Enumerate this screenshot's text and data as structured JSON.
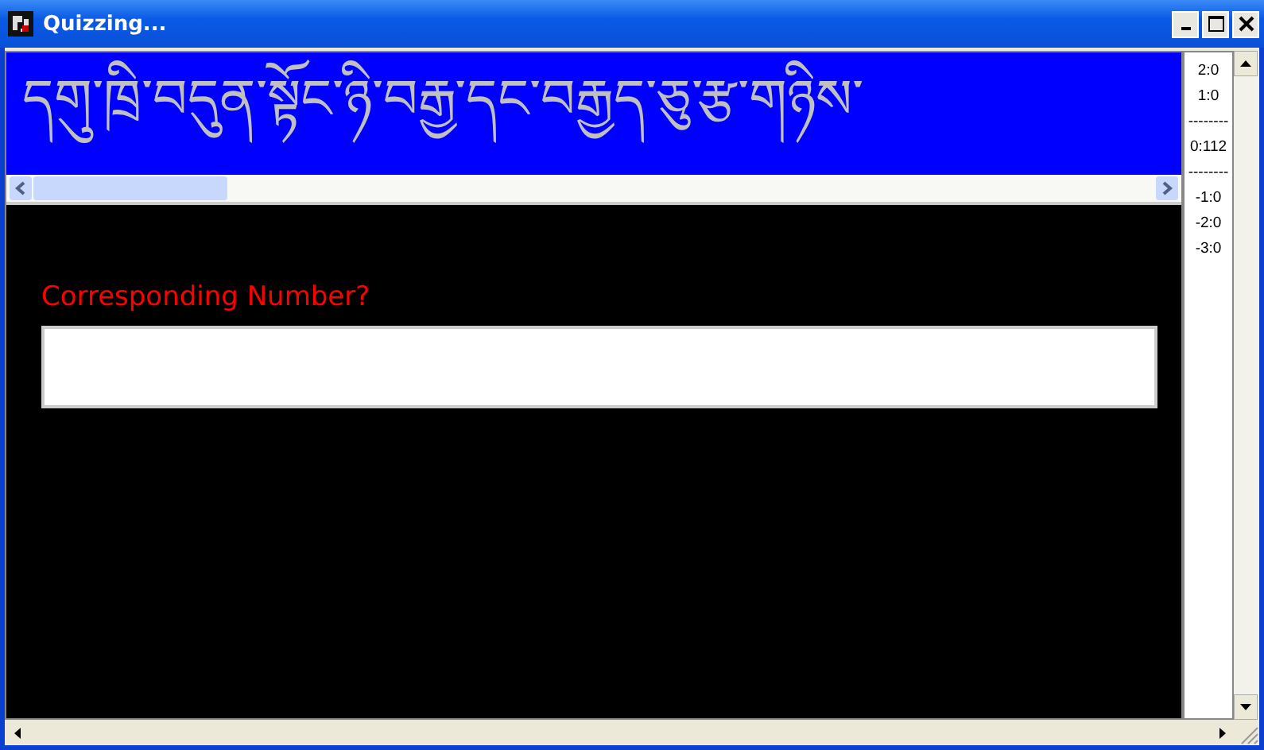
{
  "window": {
    "title": "Quizzing..."
  },
  "banner": {
    "text": "དགུ་ཁྲི་བདུན་སྟོང་ཉི་བརྒྱ་དང་བརྒྱད་ཅུ་རྩ་གཉིས་"
  },
  "prompt": {
    "label": "Corresponding Number?"
  },
  "side_list": [
    "2:0",
    "1:0",
    "--------",
    "0:112",
    "--------",
    "-1:0",
    "-2:0",
    "-3:0"
  ]
}
